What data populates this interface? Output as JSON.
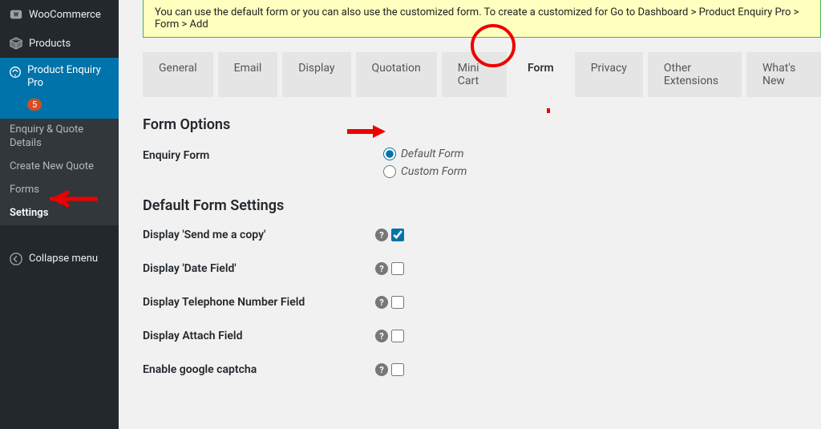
{
  "sidebar": {
    "items": [
      {
        "label": "WooCommerce",
        "icon": "woo"
      },
      {
        "label": "Products",
        "icon": "box"
      },
      {
        "label": "Product Enquiry Pro",
        "icon": "enquiry",
        "badge": "5",
        "active": true
      }
    ],
    "sub_items": [
      {
        "label": "Enquiry & Quote Details"
      },
      {
        "label": "Create New Quote"
      },
      {
        "label": "Forms"
      },
      {
        "label": "Settings",
        "current": true
      }
    ],
    "collapse_label": "Collapse menu"
  },
  "notice": {
    "text": "You can use the default form or you can also use the customized form. To create a customized for Go to Dashboard > Product Enquiry Pro > Form > Add "
  },
  "tabs": [
    {
      "label": "General"
    },
    {
      "label": "Email"
    },
    {
      "label": "Display"
    },
    {
      "label": "Quotation"
    },
    {
      "label": "Mini Cart"
    },
    {
      "label": "Form",
      "active": true
    },
    {
      "label": "Privacy"
    },
    {
      "label": "Other Extensions"
    },
    {
      "label": "What's New"
    }
  ],
  "form_options": {
    "heading": "Form Options",
    "enquiry_label": "Enquiry Form",
    "radios": [
      {
        "label": "Default Form",
        "checked": true
      },
      {
        "label": "Custom Form",
        "checked": false
      }
    ]
  },
  "default_settings": {
    "heading": "Default Form Settings",
    "rows": [
      {
        "label": "Display 'Send me a copy'",
        "checked": true
      },
      {
        "label": "Display 'Date Field'",
        "checked": false
      },
      {
        "label": "Display Telephone Number Field",
        "checked": false
      },
      {
        "label": "Display Attach Field",
        "checked": false
      },
      {
        "label": "Enable google captcha",
        "checked": false
      }
    ]
  }
}
